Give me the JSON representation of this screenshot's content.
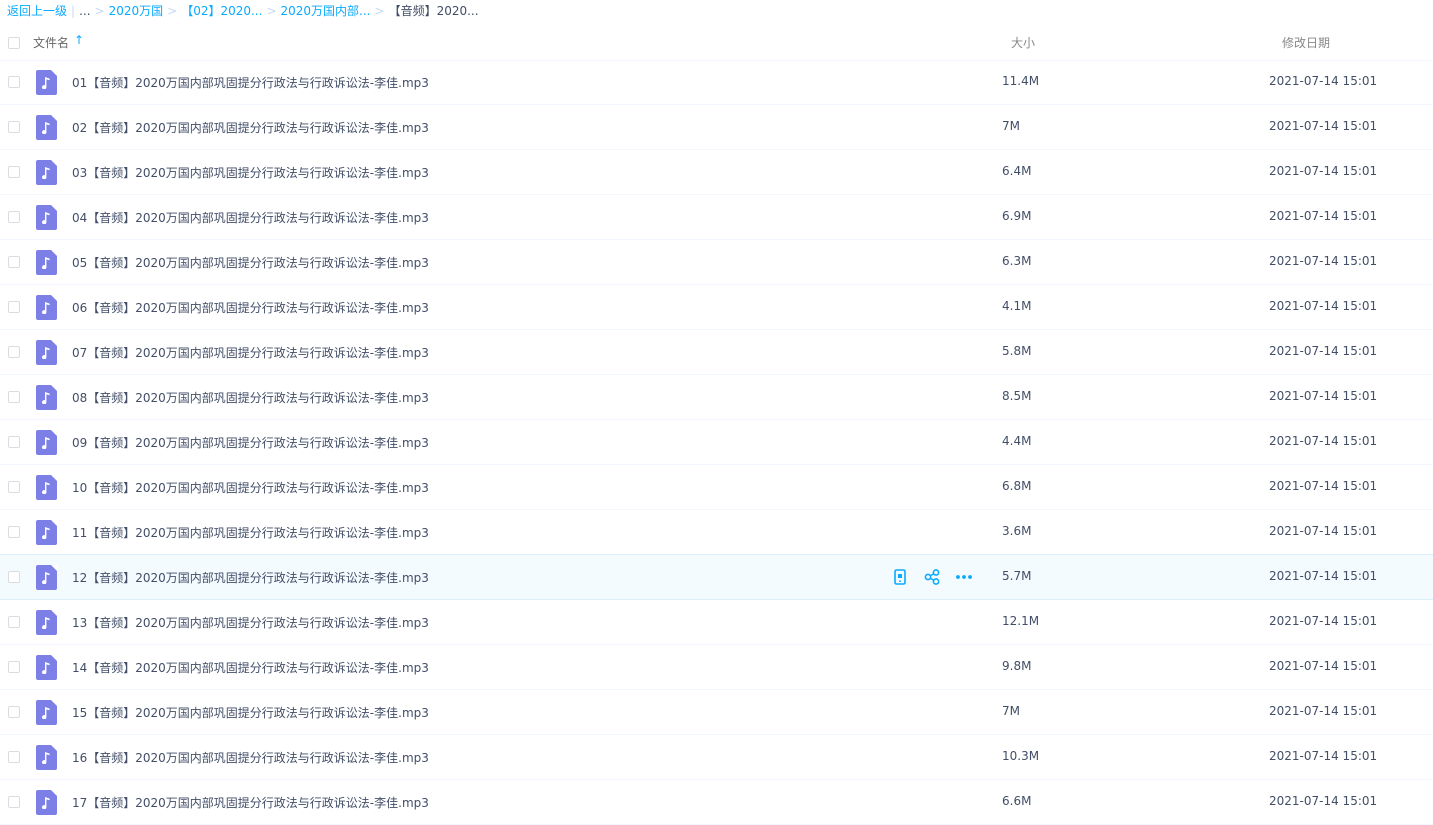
{
  "breadcrumb": {
    "back": "返回上一级",
    "sep_bar": "|",
    "ellipsis": "...",
    "sep": ">",
    "items": [
      "2020万国",
      "【02】2020...",
      "2020万国内部..."
    ],
    "current": "【音频】2020..."
  },
  "header": {
    "name": "文件名",
    "sort_icon": "↑",
    "size": "大小",
    "modified": "修改日期"
  },
  "colors": {
    "link": "#09aaff",
    "file_icon": "#7b7fe6",
    "hover_row": "#f4fbff"
  },
  "icons": {
    "file": "music-file-icon",
    "actions": [
      "phone-icon",
      "share-icon",
      "more-icon"
    ]
  },
  "files": [
    {
      "name": "01【音频】2020万国内部巩固提分行政法与行政诉讼法-李佳.mp3",
      "size": "11.4M",
      "date": "2021-07-14 15:01"
    },
    {
      "name": "02【音频】2020万国内部巩固提分行政法与行政诉讼法-李佳.mp3",
      "size": "7M",
      "date": "2021-07-14 15:01"
    },
    {
      "name": "03【音频】2020万国内部巩固提分行政法与行政诉讼法-李佳.mp3",
      "size": "6.4M",
      "date": "2021-07-14 15:01"
    },
    {
      "name": "04【音频】2020万国内部巩固提分行政法与行政诉讼法-李佳.mp3",
      "size": "6.9M",
      "date": "2021-07-14 15:01"
    },
    {
      "name": "05【音频】2020万国内部巩固提分行政法与行政诉讼法-李佳.mp3",
      "size": "6.3M",
      "date": "2021-07-14 15:01"
    },
    {
      "name": "06【音频】2020万国内部巩固提分行政法与行政诉讼法-李佳.mp3",
      "size": "4.1M",
      "date": "2021-07-14 15:01"
    },
    {
      "name": "07【音频】2020万国内部巩固提分行政法与行政诉讼法-李佳.mp3",
      "size": "5.8M",
      "date": "2021-07-14 15:01"
    },
    {
      "name": "08【音频】2020万国内部巩固提分行政法与行政诉讼法-李佳.mp3",
      "size": "8.5M",
      "date": "2021-07-14 15:01"
    },
    {
      "name": "09【音频】2020万国内部巩固提分行政法与行政诉讼法-李佳.mp3",
      "size": "4.4M",
      "date": "2021-07-14 15:01"
    },
    {
      "name": "10【音频】2020万国内部巩固提分行政法与行政诉讼法-李佳.mp3",
      "size": "6.8M",
      "date": "2021-07-14 15:01"
    },
    {
      "name": "11【音频】2020万国内部巩固提分行政法与行政诉讼法-李佳.mp3",
      "size": "3.6M",
      "date": "2021-07-14 15:01"
    },
    {
      "name": "12【音频】2020万国内部巩固提分行政法与行政诉讼法-李佳.mp3",
      "size": "5.7M",
      "date": "2021-07-14 15:01",
      "hover": true
    },
    {
      "name": "13【音频】2020万国内部巩固提分行政法与行政诉讼法-李佳.mp3",
      "size": "12.1M",
      "date": "2021-07-14 15:01"
    },
    {
      "name": "14【音频】2020万国内部巩固提分行政法与行政诉讼法-李佳.mp3",
      "size": "9.8M",
      "date": "2021-07-14 15:01"
    },
    {
      "name": "15【音频】2020万国内部巩固提分行政法与行政诉讼法-李佳.mp3",
      "size": "7M",
      "date": "2021-07-14 15:01"
    },
    {
      "name": "16【音频】2020万国内部巩固提分行政法与行政诉讼法-李佳.mp3",
      "size": "10.3M",
      "date": "2021-07-14 15:01"
    },
    {
      "name": "17【音频】2020万国内部巩固提分行政法与行政诉讼法-李佳.mp3",
      "size": "6.6M",
      "date": "2021-07-14 15:01"
    }
  ]
}
